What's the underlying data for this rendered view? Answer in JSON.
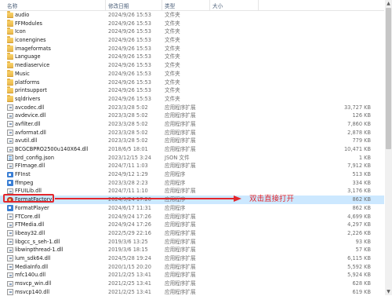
{
  "columns": {
    "name": "名称",
    "date": "修改日期",
    "type": "类型",
    "size": "大小"
  },
  "files": [
    {
      "name": "audio",
      "date": "2024/9/26 15:53",
      "type": "文件夹",
      "size": "",
      "icon": "folder-icon"
    },
    {
      "name": "FFModules",
      "date": "2024/9/26 15:53",
      "type": "文件夹",
      "size": "",
      "icon": "folder-icon"
    },
    {
      "name": "Icon",
      "date": "2024/9/26 15:53",
      "type": "文件夹",
      "size": "",
      "icon": "folder-icon"
    },
    {
      "name": "iconengines",
      "date": "2024/9/26 15:53",
      "type": "文件夹",
      "size": "",
      "icon": "folder-icon"
    },
    {
      "name": "imageformats",
      "date": "2024/9/26 15:53",
      "type": "文件夹",
      "size": "",
      "icon": "folder-icon"
    },
    {
      "name": "Language",
      "date": "2024/9/26 15:53",
      "type": "文件夹",
      "size": "",
      "icon": "folder-icon"
    },
    {
      "name": "mediaservice",
      "date": "2024/9/26 15:53",
      "type": "文件夹",
      "size": "",
      "icon": "folder-icon"
    },
    {
      "name": "Music",
      "date": "2024/9/26 15:53",
      "type": "文件夹",
      "size": "",
      "icon": "folder-icon"
    },
    {
      "name": "platforms",
      "date": "2024/9/26 15:53",
      "type": "文件夹",
      "size": "",
      "icon": "folder-icon"
    },
    {
      "name": "printsupport",
      "date": "2024/9/26 15:53",
      "type": "文件夹",
      "size": "",
      "icon": "folder-icon"
    },
    {
      "name": "sqldrivers",
      "date": "2024/9/26 15:53",
      "type": "文件夹",
      "size": "",
      "icon": "folder-icon"
    },
    {
      "name": "avcodec.dll",
      "date": "2023/3/28 5:02",
      "type": "应用程序扩展",
      "size": "33,727 KB",
      "icon": "dll-icon"
    },
    {
      "name": "avdevice.dll",
      "date": "2023/3/28 5:02",
      "type": "应用程序扩展",
      "size": "126 KB",
      "icon": "dll-icon"
    },
    {
      "name": "avfilter.dll",
      "date": "2023/3/28 5:02",
      "type": "应用程序扩展",
      "size": "7,860 KB",
      "icon": "dll-icon"
    },
    {
      "name": "avformat.dll",
      "date": "2023/3/28 5:02",
      "type": "应用程序扩展",
      "size": "2,878 KB",
      "icon": "dll-icon"
    },
    {
      "name": "avutil.dll",
      "date": "2023/3/28 5:02",
      "type": "应用程序扩展",
      "size": "779 KB",
      "icon": "dll-icon"
    },
    {
      "name": "BCGCBPRO2500u140X64.dll",
      "date": "2018/6/5 18:01",
      "type": "应用程序扩展",
      "size": "10,471 KB",
      "icon": "dll-icon"
    },
    {
      "name": "brd_config.json",
      "date": "2023/12/15 3:24",
      "type": "JSON 文件",
      "size": "1 KB",
      "icon": "json-icon"
    },
    {
      "name": "FFImage.dll",
      "date": "2024/7/11 1:03",
      "type": "应用程序扩展",
      "size": "7,912 KB",
      "icon": "dll-icon"
    },
    {
      "name": "FFInst",
      "date": "2024/9/12 1:29",
      "type": "应用程序",
      "size": "513 KB",
      "icon": "exe-icon"
    },
    {
      "name": "ffmpeg",
      "date": "2023/3/28 2:23",
      "type": "应用程序",
      "size": "334 KB",
      "icon": "exe-icon"
    },
    {
      "name": "FFUILib.dll",
      "date": "2024/7/11 1:10",
      "type": "应用程序扩展",
      "size": "3,176 KB",
      "icon": "dll-icon"
    },
    {
      "name": "FormatFactory",
      "date": "2024/9/24 17:20",
      "type": "应用程序",
      "size": "862 KB",
      "icon": "app-icon",
      "selected": true
    },
    {
      "name": "FormatPlayer",
      "date": "2024/6/17 11:31",
      "type": "应用程序",
      "size": "862 KB",
      "icon": "exe-icon"
    },
    {
      "name": "FTCore.dll",
      "date": "2024/9/24 17:26",
      "type": "应用程序扩展",
      "size": "4,699 KB",
      "icon": "dll-icon"
    },
    {
      "name": "FTMedia.dll",
      "date": "2024/9/24 17:26",
      "type": "应用程序扩展",
      "size": "4,297 KB",
      "icon": "dll-icon"
    },
    {
      "name": "libeay32.dll",
      "date": "2022/5/29 22:16",
      "type": "应用程序扩展",
      "size": "2,226 KB",
      "icon": "dll-icon"
    },
    {
      "name": "libgcc_s_seh-1.dll",
      "date": "2019/3/6 13:25",
      "type": "应用程序扩展",
      "size": "93 KB",
      "icon": "dll-icon"
    },
    {
      "name": "libwinpthread-1.dll",
      "date": "2019/3/6 18:15",
      "type": "应用程序扩展",
      "size": "57 KB",
      "icon": "dll-icon"
    },
    {
      "name": "lum_sdk64.dll",
      "date": "2024/5/28 19:24",
      "type": "应用程序扩展",
      "size": "6,115 KB",
      "icon": "dll-icon"
    },
    {
      "name": "MediaInfo.dll",
      "date": "2020/1/15 20:20",
      "type": "应用程序扩展",
      "size": "5,592 KB",
      "icon": "dll-icon"
    },
    {
      "name": "mfc140u.dll",
      "date": "2021/2/25 13:41",
      "type": "应用程序扩展",
      "size": "5,924 KB",
      "icon": "dll-icon"
    },
    {
      "name": "msvcp_win.dll",
      "date": "2021/2/25 13:41",
      "type": "应用程序扩展",
      "size": "628 KB",
      "icon": "dll-icon"
    },
    {
      "name": "msvcp140.dll",
      "date": "2021/2/25 13:41",
      "type": "应用程序扩展",
      "size": "619 KB",
      "icon": "dll-icon"
    }
  ],
  "annotation": {
    "text": "双击直接打开",
    "color": "#e3262b"
  },
  "colors": {
    "selected_row": "#cce8ff",
    "header_text": "#4c607a",
    "meta_text": "#6d6d6d"
  }
}
